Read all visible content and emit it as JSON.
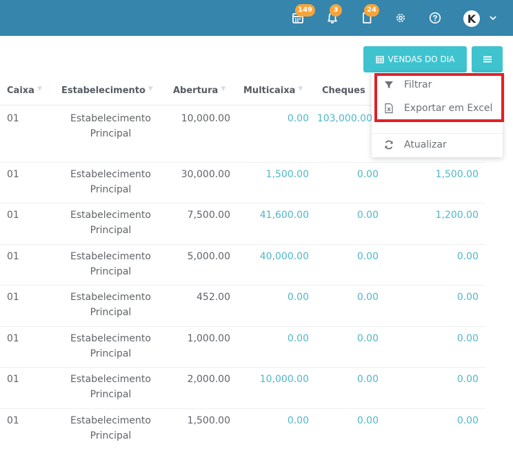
{
  "topbar": {
    "calendar_badge": "149",
    "bell_badge": "3",
    "doc_badge": "24",
    "avatar_letter": "K"
  },
  "actions": {
    "vendas_label": "VENDAS DO DIA"
  },
  "table": {
    "headers": [
      "Caixa",
      "Estabelecimento",
      "Abertura",
      "Multicaixa",
      "Cheques"
    ],
    "rows": [
      {
        "caixa": "01",
        "estab1": "Estabelecimento",
        "estab2": "Principal",
        "abertura": "10,000.00",
        "multicaixa": "0.00",
        "cheques": "103,000.00",
        "last": ""
      },
      {
        "caixa": "01",
        "estab1": "Estabelecimento",
        "estab2": "Principal",
        "abertura": "30,000.00",
        "multicaixa": "1,500.00",
        "cheques": "0.00",
        "last": "1,500.00"
      },
      {
        "caixa": "01",
        "estab1": "Estabelecimento",
        "estab2": "Principal",
        "abertura": "7,500.00",
        "multicaixa": "41,600.00",
        "cheques": "0.00",
        "last": "1,200.00"
      },
      {
        "caixa": "01",
        "estab1": "Estabelecimento",
        "estab2": "Principal",
        "abertura": "5,000.00",
        "multicaixa": "40,000.00",
        "cheques": "0.00",
        "last": "0.00"
      },
      {
        "caixa": "01",
        "estab1": "Estabelecimento",
        "estab2": "Principal",
        "abertura": "452.00",
        "multicaixa": "0.00",
        "cheques": "0.00",
        "last": "0.00"
      },
      {
        "caixa": "01",
        "estab1": "Estabelecimento",
        "estab2": "Principal",
        "abertura": "1,000.00",
        "multicaixa": "0.00",
        "cheques": "0.00",
        "last": "0.00"
      },
      {
        "caixa": "01",
        "estab1": "Estabelecimento",
        "estab2": "Principal",
        "abertura": "2,000.00",
        "multicaixa": "10,000.00",
        "cheques": "0.00",
        "last": "0.00"
      },
      {
        "caixa": "01",
        "estab1": "Estabelecimento",
        "estab2": "Principal",
        "abertura": "1,500.00",
        "multicaixa": "0.00",
        "cheques": "0.00",
        "last": "0.00"
      }
    ]
  },
  "dropdown": {
    "filtrar": "Filtrar",
    "exportar": "Exportar em Excel",
    "atualizar": "Atualizar"
  },
  "colors": {
    "topbar": "#3585ad",
    "accent": "#3fc3cf",
    "value": "#4fb7c9",
    "badge": "#f6a43a",
    "highlight": "#e21f26"
  },
  "icons": [
    "calendar-icon",
    "bell-icon",
    "document-icon",
    "gear-icon",
    "help-icon",
    "chevron-down-icon",
    "menu-icon",
    "filter-icon",
    "excel-icon",
    "refresh-icon",
    "sort-icon"
  ]
}
